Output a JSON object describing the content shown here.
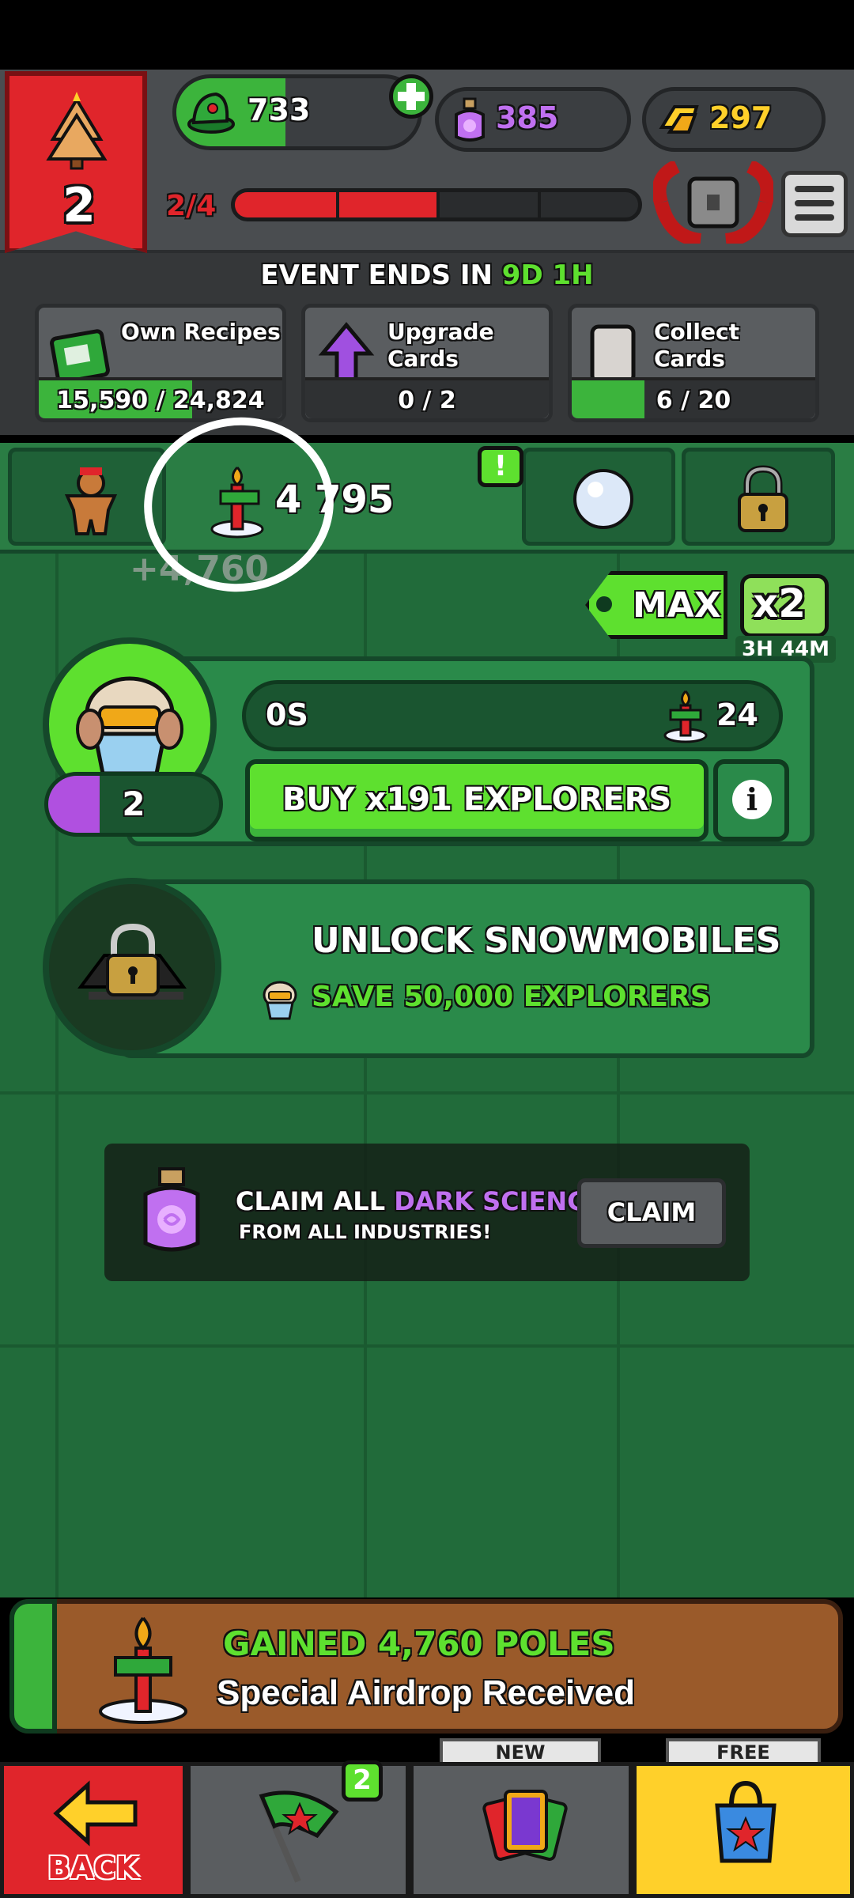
{
  "header": {
    "event_level": "2",
    "elves": "733",
    "dark_science": "385",
    "gold": "297",
    "progress_text": "2/4",
    "progress": 0.5
  },
  "event": {
    "ends_label": "EVENT ENDS IN",
    "ends_value": "9D 1H",
    "tasks": [
      {
        "label": "Own Recipes",
        "progress_text": "15,590 / 24,824",
        "progress": 0.63
      },
      {
        "label": "Upgrade Cards",
        "progress_text": "0 / 2",
        "progress": 0
      },
      {
        "label": "Collect Cards",
        "progress_text": "6 / 20",
        "progress": 0.3
      }
    ]
  },
  "tabs": {
    "poles_count": "4 795",
    "poles_gain": "+4,760",
    "alert": "!"
  },
  "multiplier": {
    "max_label": "MAX",
    "x2_label": "x2",
    "x2_timer": "3H 44M"
  },
  "explorer": {
    "level": "2",
    "timer": "0S",
    "poles_per": "24",
    "buy_label": "BUY x191 EXPLORERS",
    "info": "i"
  },
  "unlock": {
    "title": "UNLOCK SNOWMOBILES",
    "subtitle": "SAVE 50,000 EXPLORERS"
  },
  "science": {
    "title_prefix": "CLAIM ALL ",
    "title_highlight": "DARK SCIENCE",
    "subtitle": "FROM ALL INDUSTRIES!",
    "claim_label": "CLAIM"
  },
  "notification": {
    "title": "GAINED 4,760 POLES",
    "subtitle": "Special Airdrop Received"
  },
  "bottom_nav": {
    "back_label": "BACK",
    "flags_badge": "2",
    "cards_tag": "NEW",
    "shop_tag": "FREE"
  },
  "colors": {
    "accent_green": "#5ee02f",
    "event_red": "#e0252b",
    "science_purple": "#c070f0",
    "gold": "#ffd02a"
  }
}
